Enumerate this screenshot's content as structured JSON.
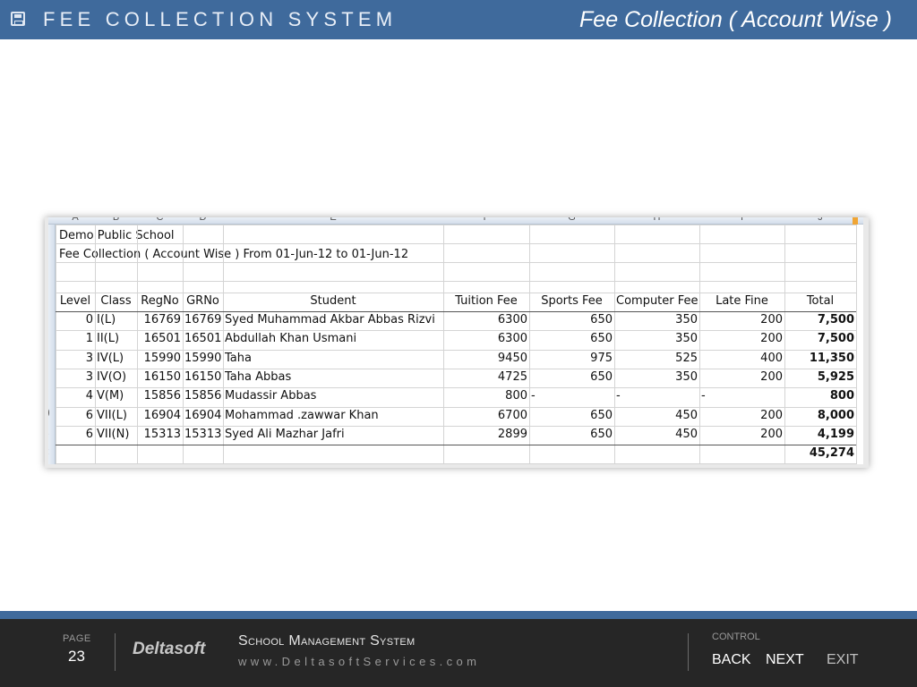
{
  "header": {
    "app_title": "FEE COLLECTION SYSTEM",
    "slide_title": "Fee Collection ( Account Wise )"
  },
  "sheet": {
    "column_letters": [
      "A",
      "B",
      "C",
      "D",
      "E",
      "F",
      "G",
      "H",
      "I",
      "J"
    ],
    "school_name": "Demo Public School",
    "report_title": "Fee Collection ( Account Wise ) From 01-Jun-12 to 01-Jun-12",
    "headers": [
      "Level",
      "Class",
      "RegNo",
      "GRNo",
      "Student",
      "Tuition Fee",
      "Sports Fee",
      "Computer Fee",
      "Late Fine",
      "Total"
    ],
    "rows": [
      [
        "0",
        "I(L)",
        "16769",
        "16769",
        "Syed Muhammad Akbar Abbas Rizvi",
        "6300",
        "650",
        "350",
        "200",
        "7,500"
      ],
      [
        "1",
        "II(L)",
        "16501",
        "16501",
        "Abdullah Khan Usmani",
        "6300",
        "650",
        "350",
        "200",
        "7,500"
      ],
      [
        "3",
        "IV(L)",
        "15990",
        "15990",
        "Taha",
        "9450",
        "975",
        "525",
        "400",
        "11,350"
      ],
      [
        "3",
        "IV(O)",
        "16150",
        "16150",
        "Taha Abbas",
        "4725",
        "650",
        "350",
        "200",
        "5,925"
      ],
      [
        "4",
        "V(M)",
        "15856",
        "15856",
        "Mudassir Abbas",
        "800",
        "-",
        "-",
        "-",
        "800"
      ],
      [
        "6",
        "VII(L)",
        "16904",
        "16904",
        "Mohammad .zawwar Khan",
        "6700",
        "650",
        "450",
        "200",
        "8,000"
      ],
      [
        "6",
        "VII(N)",
        "15313",
        "15313",
        "Syed Ali Mazhar Jafri",
        "2899",
        "650",
        "450",
        "200",
        "4,199"
      ]
    ],
    "grand_total": "45,274"
  },
  "footer": {
    "page_label": "PAGE",
    "page_number": "23",
    "brand": "Deltasoft",
    "system_name": "School Management System",
    "website": "www.DeltasoftServices.com",
    "control_label": "CONTROL",
    "back_label": "BACK",
    "next_label": "NEXT",
    "exit_label": "EXIT"
  },
  "colors": {
    "header_bg": "#3f6a9c",
    "footer_bg": "#262626"
  }
}
